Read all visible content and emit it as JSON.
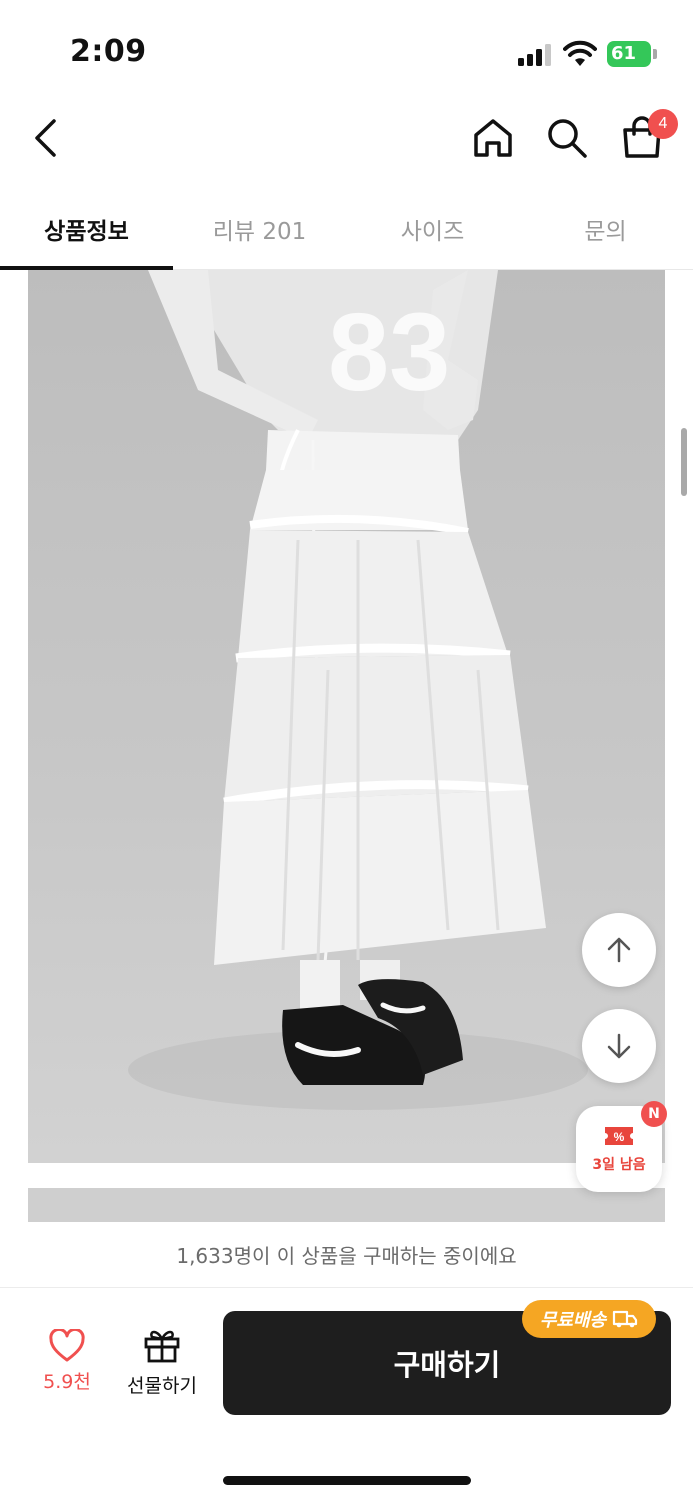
{
  "status_bar": {
    "time": "2:09",
    "battery": "61"
  },
  "header": {
    "cart_count": "4"
  },
  "tabs": [
    {
      "label": "상품정보",
      "active": true
    },
    {
      "label": "리뷰 201",
      "active": false
    },
    {
      "label": "사이즈",
      "active": false
    },
    {
      "label": "문의",
      "active": false
    }
  ],
  "image_text": "83",
  "floating": {
    "coupon_label": "3일 남음",
    "coupon_badge": "N"
  },
  "notice": "1,633명이 이 상품을 구매하는 중이에요",
  "bottom_bar": {
    "like_count": "5.9천",
    "gift_label": "선물하기",
    "buy_label": "구매하기",
    "free_shipping": "무료배송"
  },
  "colors": {
    "accent_red": "#f0504f",
    "shipping_orange": "#f5a623",
    "buy_button": "#1e1e1e",
    "battery_green": "#34c759"
  }
}
